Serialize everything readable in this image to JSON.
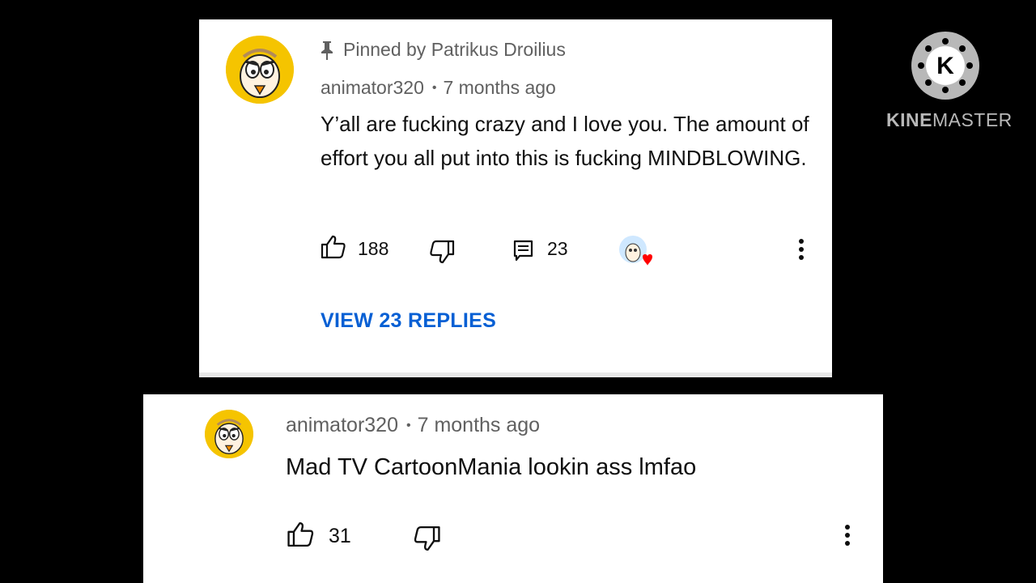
{
  "pinned_comment": {
    "pinned_by": "Pinned by Patrikus Droilius",
    "author": "animator320",
    "time": "7 months ago",
    "text": "Y’all are fucking crazy and I love you. The amount of effort you all put into this is fucking MINDBLOWING.",
    "likes": "188",
    "replies_count": "23",
    "view_replies_label": "VIEW 23 REPLIES",
    "icons": [
      "pin-icon",
      "thumbs-up-icon",
      "thumbs-down-icon",
      "reply-icon",
      "creator-heart-icon",
      "more-options-icon"
    ]
  },
  "reply_comment": {
    "author": "animator320",
    "time": "7 months ago",
    "text": "Mad TV CartoonMania lookin ass lmfao",
    "likes": "31",
    "icons": [
      "thumbs-up-icon",
      "thumbs-down-icon",
      "more-options-icon"
    ]
  },
  "watermark": {
    "logo_letter": "K",
    "brand_first": "KINE",
    "brand_second": "MASTER"
  },
  "colors": {
    "background": "#000000",
    "card": "#ffffff",
    "link_blue": "#065fd4",
    "meta_gray": "#606060",
    "avatar_yellow": "#f5c400",
    "heart_red": "#ff0000"
  }
}
